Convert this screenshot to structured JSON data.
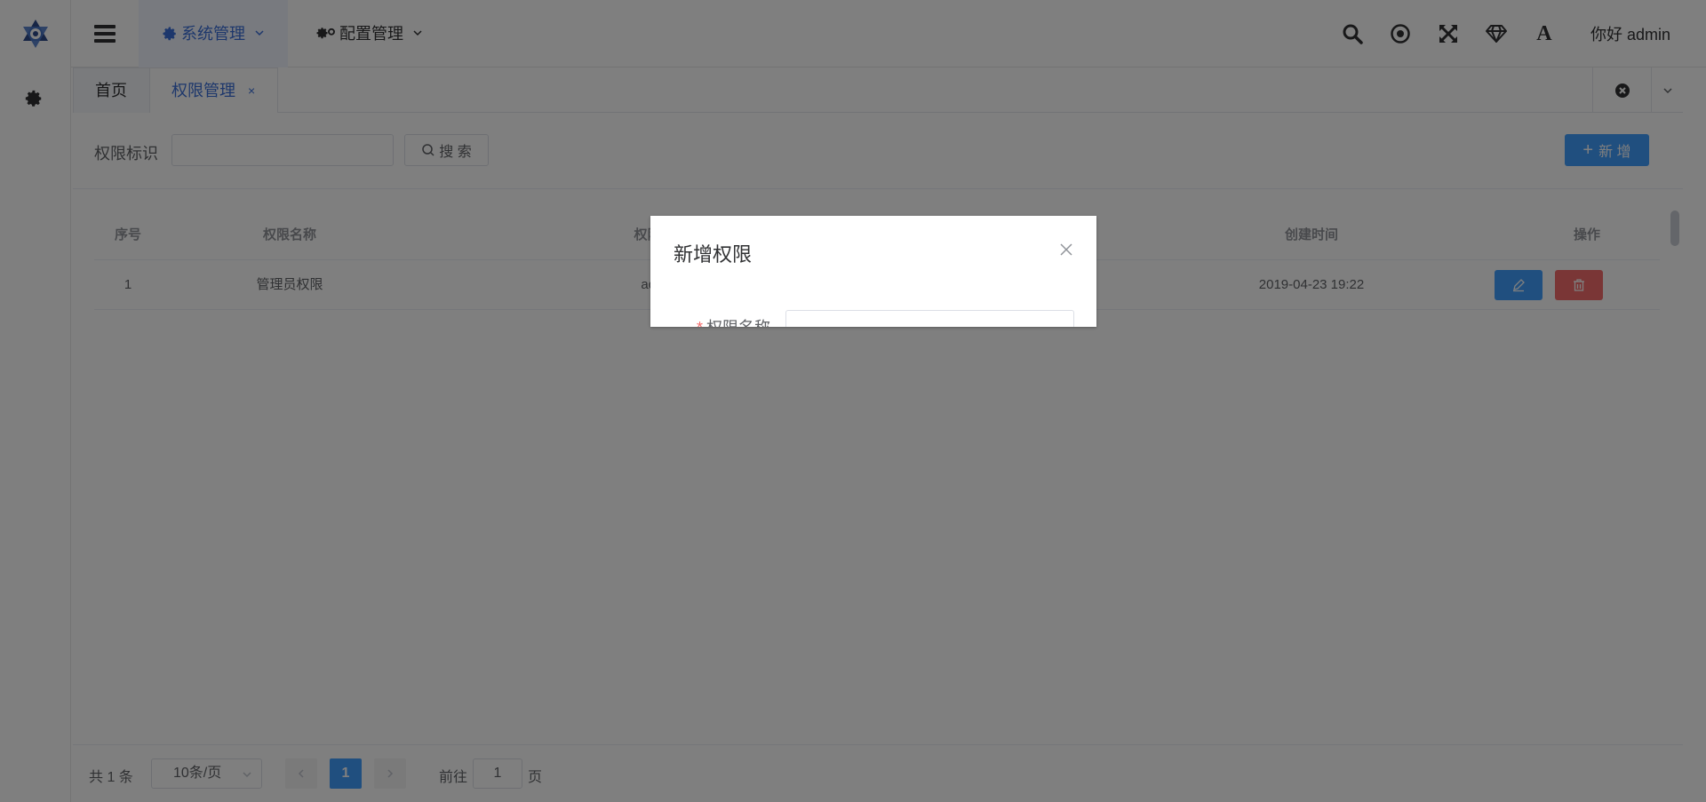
{
  "header": {
    "menus": [
      {
        "label": "系统管理"
      },
      {
        "label": "配置管理"
      }
    ],
    "greeting": "你好 admin",
    "font_icon_glyph": "A"
  },
  "tabs": [
    {
      "label": "首页"
    },
    {
      "label": "权限管理",
      "close": "×"
    }
  ],
  "search": {
    "label": "权限标识",
    "value": "",
    "button_label": "搜 索",
    "add_label": "新 增",
    "add_plus": "+"
  },
  "table": {
    "columns": [
      "序号",
      "权限名称",
      "权限标",
      "创建时间",
      "操作"
    ],
    "rows": [
      {
        "index": "1",
        "name": "管理员权限",
        "code": "adm",
        "created": "2019-04-23 19:22"
      }
    ]
  },
  "pagination": {
    "total": "共 1 条",
    "page_size": "10条/页",
    "current": "1",
    "goto_label": "前往",
    "goto_value": "1",
    "goto_unit": "页"
  },
  "dialog": {
    "title": "新增权限",
    "field_label": "权限名称",
    "required_mark": "*"
  },
  "colors": {
    "primary": "#409eff",
    "danger": "#f56c6c",
    "active_menu": "#3a6fd8"
  }
}
